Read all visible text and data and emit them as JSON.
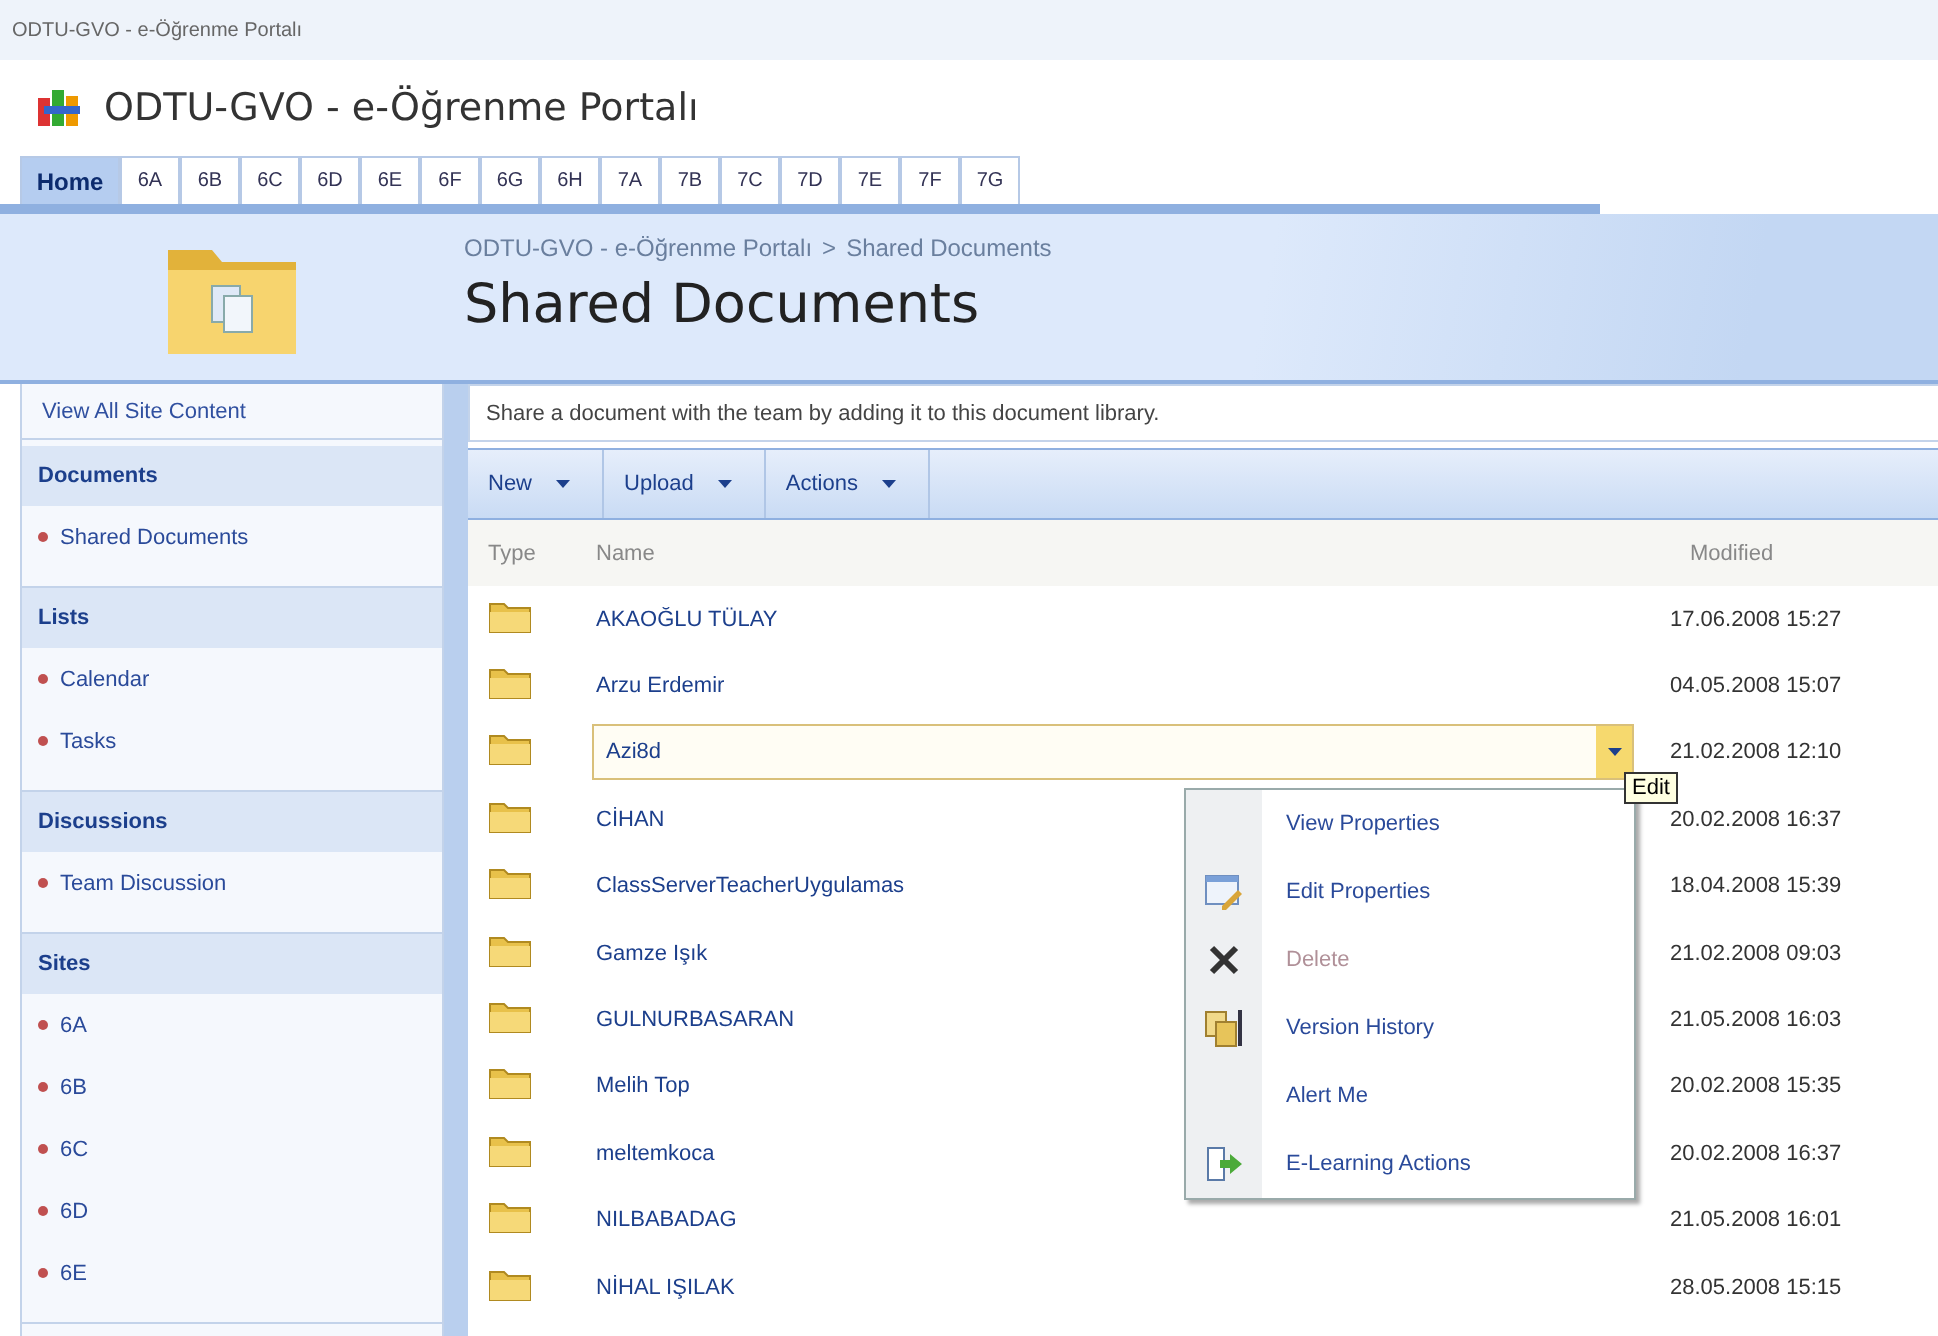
{
  "browser_title": "ODTU-GVO - e-Öğrenme Portalı",
  "site_title": "ODTU-GVO - e-Öğrenme Portalı",
  "tabs": [
    {
      "label": "Home",
      "selected": true
    },
    {
      "label": "6A",
      "selected": false
    },
    {
      "label": "6B",
      "selected": false
    },
    {
      "label": "6C",
      "selected": false
    },
    {
      "label": "6D",
      "selected": false
    },
    {
      "label": "6E",
      "selected": false
    },
    {
      "label": "6F",
      "selected": false
    },
    {
      "label": "6G",
      "selected": false
    },
    {
      "label": "6H",
      "selected": false
    },
    {
      "label": "7A",
      "selected": false
    },
    {
      "label": "7B",
      "selected": false
    },
    {
      "label": "7C",
      "selected": false
    },
    {
      "label": "7D",
      "selected": false
    },
    {
      "label": "7E",
      "selected": false
    },
    {
      "label": "7F",
      "selected": false
    },
    {
      "label": "7G",
      "selected": false
    }
  ],
  "breadcrumb": {
    "site": "ODTU-GVO - e-Öğrenme Portalı",
    "separator": ">",
    "page": "Shared Documents"
  },
  "page_title": "Shared Documents",
  "sidebar": {
    "view_all": "View All Site Content",
    "sections": [
      {
        "heading": "Documents",
        "items": [
          "Shared Documents"
        ]
      },
      {
        "heading": "Lists",
        "items": [
          "Calendar",
          "Tasks"
        ]
      },
      {
        "heading": "Discussions",
        "items": [
          "Team Discussion"
        ]
      },
      {
        "heading": "Sites",
        "items": [
          "6A",
          "6B",
          "6C",
          "6D",
          "6E"
        ]
      }
    ]
  },
  "description": "Share a document with the team by adding it to this document library.",
  "toolbar": [
    {
      "label": "New",
      "dropdown": true
    },
    {
      "label": "Upload",
      "dropdown": true
    },
    {
      "label": "Actions",
      "dropdown": true
    }
  ],
  "table": {
    "columns": [
      "Type",
      "Name",
      "Modified"
    ],
    "rows": [
      {
        "name": "AKAOĞLU TÜLAY",
        "modified": "17.06.2008 15:27",
        "selected": false
      },
      {
        "name": "Arzu Erdemir",
        "modified": "04.05.2008 15:07",
        "selected": false
      },
      {
        "name": "Azi8d",
        "modified": "21.02.2008 12:10",
        "selected": true
      },
      {
        "name": "CİHAN",
        "modified": "20.02.2008 16:37",
        "selected": false
      },
      {
        "name": "ClassServerTeacherUygulamas",
        "modified": "18.04.2008 15:39",
        "selected": false
      },
      {
        "name": "Gamze Işık",
        "modified": "21.02.2008 09:03",
        "selected": false
      },
      {
        "name": "GULNURBASARAN",
        "modified": "21.05.2008 16:03",
        "selected": false
      },
      {
        "name": "Melih Top",
        "modified": "20.02.2008 15:35",
        "selected": false
      },
      {
        "name": "meltemkoca",
        "modified": "20.02.2008 16:37",
        "selected": false
      },
      {
        "name": "NILBABADAG",
        "modified": "21.05.2008 16:01",
        "selected": false
      },
      {
        "name": "NİHAL IŞILAK",
        "modified": "28.05.2008 15:15",
        "selected": false
      }
    ]
  },
  "context_menu": {
    "items": [
      {
        "label": "View Properties",
        "kind": "plain",
        "disabled": false
      },
      {
        "label": "Edit Properties",
        "kind": "edit",
        "disabled": false
      },
      {
        "label": "Delete",
        "kind": "delete",
        "disabled": true
      },
      {
        "label": "Version History",
        "kind": "history",
        "disabled": false
      },
      {
        "label": "Alert Me",
        "kind": "plain",
        "disabled": false
      },
      {
        "label": "E-Learning Actions",
        "kind": "workflow",
        "disabled": false
      }
    ]
  },
  "tooltip": "Edit"
}
